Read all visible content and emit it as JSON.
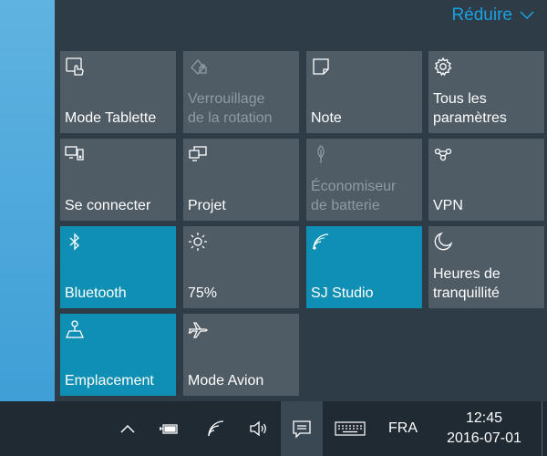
{
  "action_center": {
    "collapse_label": "Réduire",
    "tiles": [
      {
        "label": "Mode Tablette",
        "icon": "tablet-mode-icon",
        "state": "off"
      },
      {
        "label": "Verrouillage\nde la rotation",
        "icon": "rotation-lock-icon",
        "state": "disabled"
      },
      {
        "label": "Note",
        "icon": "note-icon",
        "state": "off"
      },
      {
        "label": "Tous les\nparamètres",
        "icon": "settings-gear-icon",
        "state": "off"
      },
      {
        "label": "Se connecter",
        "icon": "connect-icon",
        "state": "off"
      },
      {
        "label": "Projet",
        "icon": "project-icon",
        "state": "off"
      },
      {
        "label": "Économiseur\nde batterie",
        "icon": "battery-saver-icon",
        "state": "disabled"
      },
      {
        "label": "VPN",
        "icon": "vpn-icon",
        "state": "off"
      },
      {
        "label": "Bluetooth",
        "icon": "bluetooth-icon",
        "state": "on"
      },
      {
        "label": "75%",
        "icon": "brightness-icon",
        "state": "off"
      },
      {
        "label": "SJ Studio",
        "icon": "wifi-icon",
        "state": "on"
      },
      {
        "label": "Heures de\ntranquillité",
        "icon": "quiet-hours-moon-icon",
        "state": "off"
      },
      {
        "label": "Emplacement",
        "icon": "location-icon",
        "state": "on"
      },
      {
        "label": "Mode Avion",
        "icon": "airplane-icon",
        "state": "off"
      }
    ]
  },
  "taskbar": {
    "language": "FRA",
    "time": "12:45",
    "date": "2016-07-01"
  },
  "colors": {
    "accent": "#1ba1e2",
    "tile_on": "#0f8fb3",
    "tile_off": "#4f5c66",
    "panel_bg": "#2d3c47",
    "taskbar_bg": "#1f2a33"
  }
}
